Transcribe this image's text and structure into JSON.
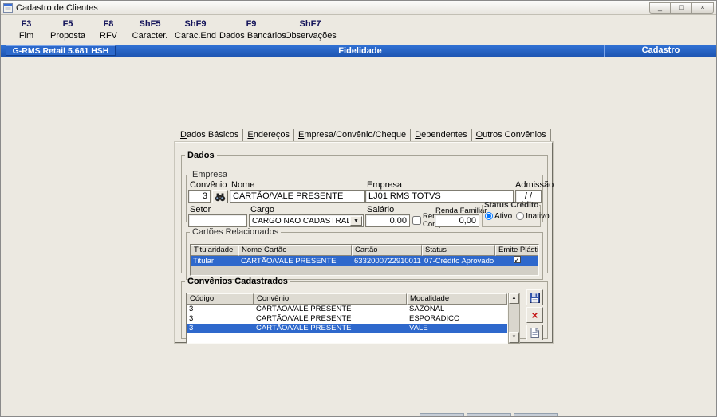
{
  "window": {
    "title": "Cadastro de Clientes",
    "controls": {
      "minimize": "_",
      "maximize": "□",
      "close": "×"
    }
  },
  "toolbar": {
    "items": [
      {
        "key": "F3",
        "label": "Fim"
      },
      {
        "key": "F5",
        "label": "Proposta"
      },
      {
        "key": "F8",
        "label": "RFV"
      },
      {
        "key": "ShF5",
        "label": "Caracter."
      },
      {
        "key": "ShF9",
        "label": "Carac.End"
      },
      {
        "key": "F9",
        "label": "Dados Bancários"
      },
      {
        "key": "ShF7",
        "label": "Observações"
      }
    ]
  },
  "statusbar": {
    "left": "G-RMS Retail 5.681 HSH",
    "center": "Fidelidade",
    "right": "Cadastro"
  },
  "tabs": {
    "items": [
      {
        "label": "Dados Básicos"
      },
      {
        "label": "Endereços"
      },
      {
        "label": "Empresa/Convênio/Cheque"
      },
      {
        "label": "Dependentes"
      },
      {
        "label": "Outros Convênios"
      }
    ],
    "active": "Outros Convênios"
  },
  "dados": {
    "title": "Dados",
    "empresa": {
      "title": "Empresa",
      "convenio_label": "Convênio",
      "convenio_value": "3",
      "nome_label": "Nome",
      "nome_value": "CARTÃO/VALE PRESENTE",
      "empresa_label": "Empresa",
      "empresa_value": "LJ01 RMS TOTVS",
      "admissao_label": "Admissão",
      "admissao_value": "/ /",
      "setor_label": "Setor",
      "setor_value": "",
      "cargo_label": "Cargo",
      "cargo_value": "CARGO NAO CADASTRADO",
      "salario_label": "Salário",
      "salario_value": "0,00",
      "renda_compr_line1": "Renda",
      "renda_compr_line2": "Compr.",
      "renda_compr_checked": false,
      "renda_familiar_label": "Renda Familiar",
      "renda_familiar_value": "0,00",
      "status_credito_label": "Status Crédito",
      "status_ativo_label": "Ativo",
      "status_inativo_label": "Inativo",
      "status_ativo_checked": true,
      "status_inativo_checked": false
    },
    "cartoes": {
      "title": "Cartões Relacionados",
      "headers": [
        "Titularidade",
        "Nome Cartão",
        "Cartão",
        "Status",
        "Emite Plástico"
      ],
      "row": {
        "titularidade": "Titular",
        "nome_cartao": "CARTÃO/VALE PRESENTE",
        "cartao": "6332000722910011",
        "status": "07-Crédito Aprovado",
        "emite_plastico": true
      }
    }
  },
  "convenios": {
    "title": "Convênios Cadastrados",
    "headers": [
      "Código",
      "Convênio",
      "Modalidade"
    ],
    "rows": [
      {
        "codigo": "3",
        "convenio": "CARTÃO/VALE PRESENTE",
        "modalidade": "SAZONAL"
      },
      {
        "codigo": "3",
        "convenio": "CARTÃO/VALE PRESENTE",
        "modalidade": "ESPORADICO"
      },
      {
        "codigo": "3",
        "convenio": "CARTÃO/VALE PRESENTE",
        "modalidade": "VALE"
      }
    ],
    "selected_row_index": 2
  },
  "icons": {
    "search": "binoculars",
    "dropdown_arrow": "▼",
    "scroll_up": "▲",
    "scroll_down": "▼",
    "delete_x": "×",
    "save": "floppy-disk",
    "document": "blank-page"
  },
  "colors": {
    "band_blue": "#2665c4",
    "selection_blue": "#2e68cc",
    "window_bg": "#ece9e1"
  }
}
